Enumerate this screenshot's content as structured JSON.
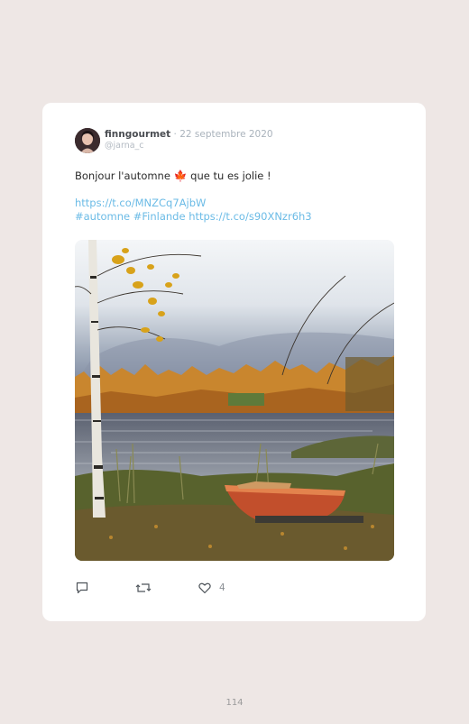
{
  "tweet": {
    "author": "finngourmet",
    "separator": " · ",
    "date": "22 septembre 2020",
    "handle": "@jarna_c",
    "text_before": "Bonjour l'automne ",
    "emoji": "🍁",
    "text_after": " que tu es jolie !",
    "link": "https://t.co/MNZCq7AjbW",
    "hashtags": "#automne #Finlande",
    "link2": "https://t.co/s90XNzr6h3",
    "likes": "4"
  },
  "icons": {
    "reply": "speech-bubble-icon",
    "retweet": "retweet-icon",
    "like": "heart-icon"
  },
  "footer": {
    "page_number": "114"
  }
}
